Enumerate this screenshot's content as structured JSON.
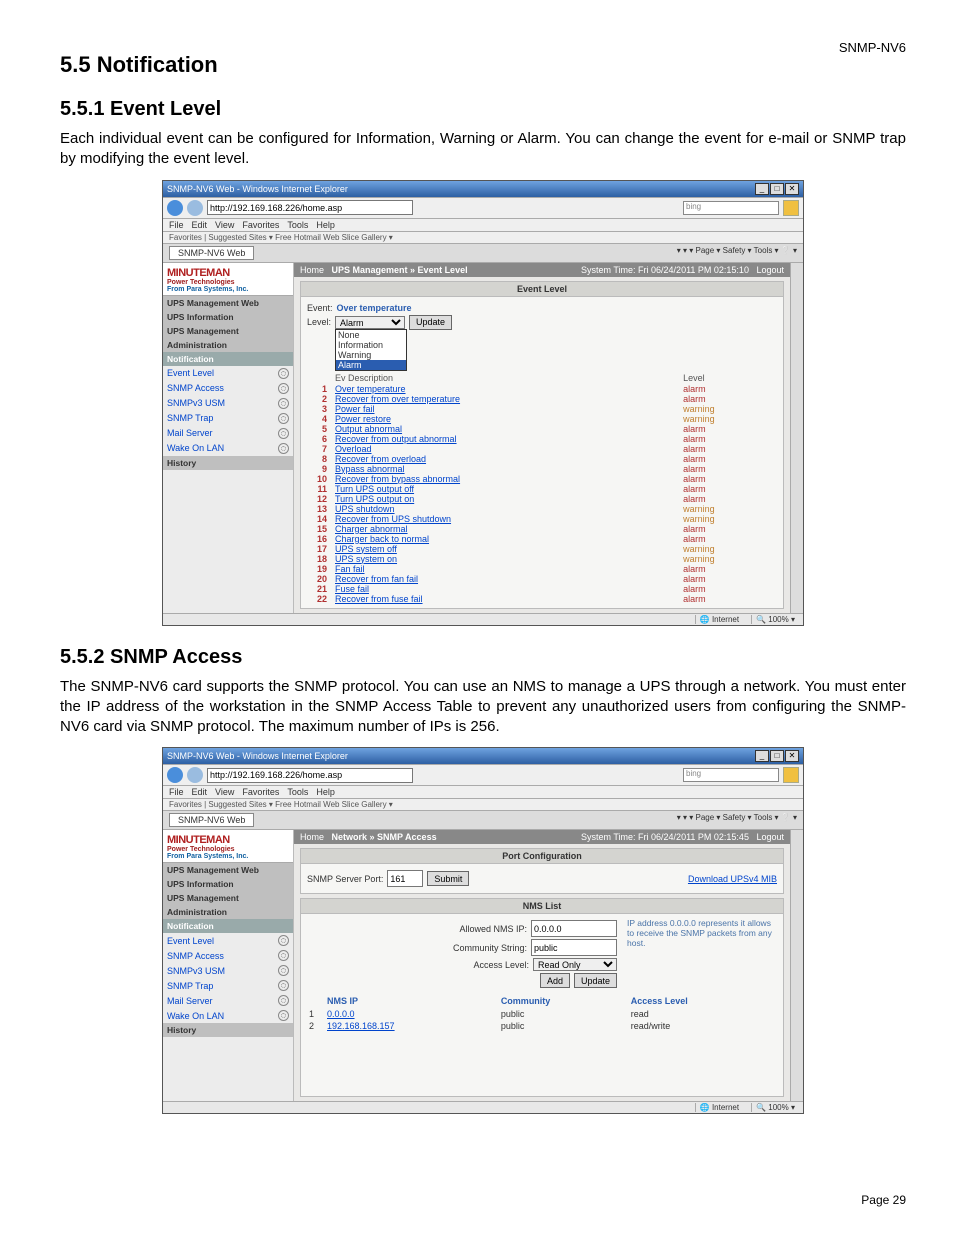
{
  "doc_header": "SNMP-NV6",
  "page_footer": "Page 29",
  "sections": {
    "s55": "5.5 Notification",
    "s551_title": "5.5.1 Event Level",
    "s551_body": "Each individual event can be configured for Information, Warning or Alarm. You can change the event for e-mail or SNMP trap by modifying the event level.",
    "s552_title": "5.5.2 SNMP Access",
    "s552_body": "The SNMP-NV6 card supports the SNMP protocol. You can use an NMS to manage a UPS through a network. You must enter the IP address of the workstation in the SNMP Access Table to prevent any unauthorized users from configuring the SNMP-NV6 card via SNMP protocol. The maximum number of IPs is 256."
  },
  "browser": {
    "title": "SNMP-NV6 Web - Windows Internet Explorer",
    "url": "http://192.169.168.226/home.asp",
    "search_placeholder": "bing",
    "menus": [
      "File",
      "Edit",
      "View",
      "Favorites",
      "Tools",
      "Help"
    ],
    "fav_text": "Favorites   |  Suggested Sites ▾   Free Hotmail   Web Slice Gallery ▾",
    "tab": "SNMP-NV6 Web",
    "toolbar_right": "▾  ▾  ▾  Page ▾  Safety ▾  Tools ▾  ❔ ▾",
    "status_internet": "Internet",
    "status_zoom": "100%"
  },
  "brand": {
    "line1": "MINUTEMAN",
    "line2": "Power Technologies",
    "line3": "From Para Systems, Inc."
  },
  "sidebar": {
    "group_title": "UPS Management Web",
    "groups": [
      "UPS Information",
      "UPS Management",
      "Administration",
      "Notification"
    ],
    "notif_items": [
      "Event Level",
      "SNMP Access",
      "SNMPv3 USM",
      "SNMP Trap",
      "Mail Server",
      "Wake On LAN"
    ],
    "history": "History"
  },
  "screenshot1": {
    "home": "Home",
    "breadcrumb": "UPS Management » Event Level",
    "system_time": "System Time: Fri 06/24/2011 PM 02:15:10",
    "logout": "Logout",
    "panel_title": "Event Level",
    "event_label": "Event:",
    "event_value": "Over temperature",
    "level_label": "Level:",
    "level_selected": "Alarm",
    "level_options": [
      "None",
      "Information",
      "Warning",
      "Alarm"
    ],
    "update_btn": "Update",
    "col_desc": "Description",
    "col_level": "Level",
    "events": [
      {
        "n": 1,
        "d": "Over temperature",
        "l": "alarm"
      },
      {
        "n": 2,
        "d": "Recover from over temperature",
        "l": "alarm"
      },
      {
        "n": 3,
        "d": "Power fail",
        "l": "warning"
      },
      {
        "n": 4,
        "d": "Power restore",
        "l": "warning"
      },
      {
        "n": 5,
        "d": "Output abnormal",
        "l": "alarm"
      },
      {
        "n": 6,
        "d": "Recover from output abnormal",
        "l": "alarm"
      },
      {
        "n": 7,
        "d": "Overload",
        "l": "alarm"
      },
      {
        "n": 8,
        "d": "Recover from overload",
        "l": "alarm"
      },
      {
        "n": 9,
        "d": "Bypass abnormal",
        "l": "alarm"
      },
      {
        "n": 10,
        "d": "Recover from bypass abnormal",
        "l": "alarm"
      },
      {
        "n": 11,
        "d": "Turn UPS output off",
        "l": "alarm"
      },
      {
        "n": 12,
        "d": "Turn UPS output on",
        "l": "alarm"
      },
      {
        "n": 13,
        "d": "UPS shutdown",
        "l": "warning"
      },
      {
        "n": 14,
        "d": "Recover from UPS shutdown",
        "l": "warning"
      },
      {
        "n": 15,
        "d": "Charger abnormal",
        "l": "alarm"
      },
      {
        "n": 16,
        "d": "Charger back to normal",
        "l": "alarm"
      },
      {
        "n": 17,
        "d": "UPS system off",
        "l": "warning"
      },
      {
        "n": 18,
        "d": "UPS system on",
        "l": "warning"
      },
      {
        "n": 19,
        "d": "Fan fail",
        "l": "alarm"
      },
      {
        "n": 20,
        "d": "Recover from fan fail",
        "l": "alarm"
      },
      {
        "n": 21,
        "d": "Fuse fail",
        "l": "alarm"
      },
      {
        "n": 22,
        "d": "Recover from fuse fail",
        "l": "alarm"
      }
    ]
  },
  "screenshot2": {
    "home": "Home",
    "breadcrumb": "Network » SNMP Access",
    "system_time": "System Time: Fri 06/24/2011 PM 02:15:45",
    "logout": "Logout",
    "panel1_title": "Port Configuration",
    "port_label": "SNMP Server Port:",
    "port_value": "161",
    "submit_btn": "Submit",
    "download_link": "Download UPSv4 MIB",
    "panel2_title": "NMS List",
    "allowed_label": "Allowed NMS IP:",
    "allowed_value": "0.0.0.0",
    "community_label": "Community String:",
    "community_value": "public",
    "access_label": "Access Level:",
    "access_value": "Read Only",
    "add_btn": "Add",
    "update_btn": "Update",
    "hint": "IP address 0.0.0.0 represents it allows to receive the SNMP packets from any host.",
    "cols": {
      "ip": "NMS IP",
      "comm": "Community",
      "acc": "Access Level"
    },
    "rows": [
      {
        "n": 1,
        "ip": "0.0.0.0",
        "comm": "public",
        "acc": "read"
      },
      {
        "n": 2,
        "ip": "192.168.168.157",
        "comm": "public",
        "acc": "read/write"
      }
    ]
  }
}
